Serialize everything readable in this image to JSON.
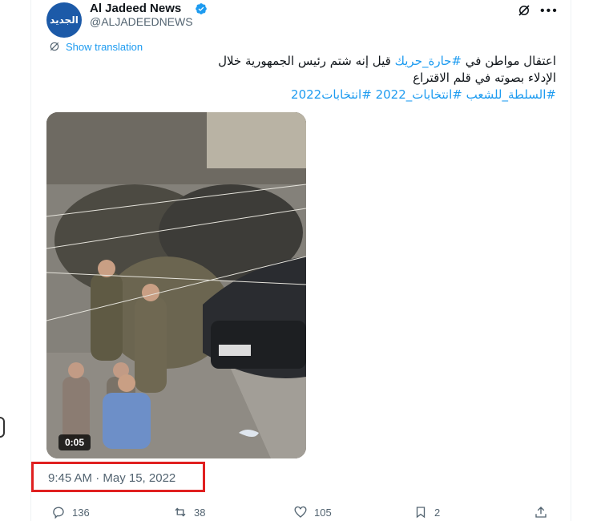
{
  "author": {
    "name": "Al Jadeed News",
    "handle": "@ALJADEEDNEWS",
    "avatar_text": "الجديد",
    "verified": true
  },
  "translate": {
    "label": "Show translation"
  },
  "tweet": {
    "part1": "اعتقال مواطن في ",
    "tag1": "#حارة_حريك",
    "part2": " قيل إنه شتم رئيس الجمهورية خلال الإدلاء بصوته في قلم الاقتراع",
    "tag2": "#السلطة_للشعب",
    "tag3": "#انتخابات_2022",
    "tag4": "#انتخابات2022"
  },
  "media": {
    "duration": "0:05"
  },
  "timestamp": "9:45 AM · May 15, 2022",
  "actions": {
    "replies": "136",
    "reposts": "38",
    "likes": "105",
    "bookmarks": "2"
  },
  "colors": {
    "link": "#1d9bf0",
    "highlight": "#e02020",
    "muted": "#536471"
  }
}
